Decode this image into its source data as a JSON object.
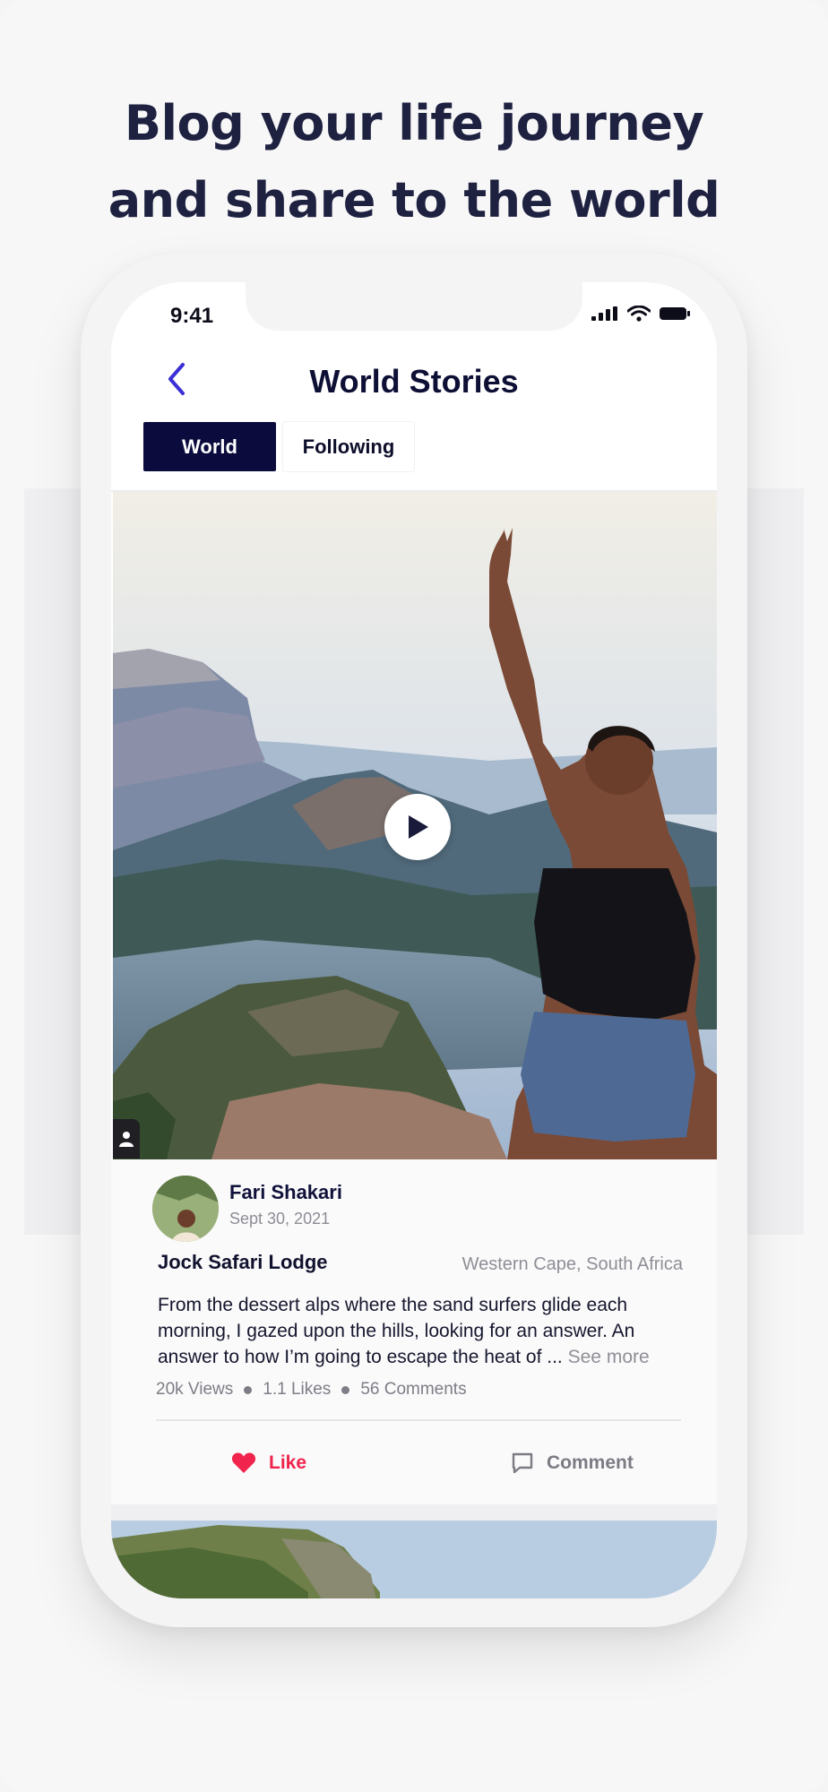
{
  "promo": {
    "headline_line1": "Blog your life journey",
    "headline_line2": "and share to the world"
  },
  "status_bar": {
    "time": "9:41",
    "icons": [
      "signal-icon",
      "wifi-icon",
      "battery-icon"
    ]
  },
  "header": {
    "title": "World Stories",
    "back_icon": "chevron-left-icon"
  },
  "tabs": [
    {
      "label": "World",
      "active": true
    },
    {
      "label": "Following",
      "active": false
    }
  ],
  "post": {
    "author": "Fari Shakari",
    "date": "Sept 30, 2021",
    "place": "Jock Safari Lodge",
    "location": "Western Cape, South Africa",
    "body": "From the dessert alps where the sand surfers glide each morning, I gazed upon the hills, looking for an answer. An answer to how I’m going to escape the heat of ...",
    "see_more": "See more",
    "views": "20k Views",
    "likes": "1.1 Likes",
    "comments": "56 Comments",
    "like_label": "Like",
    "comment_label": "Comment"
  },
  "colors": {
    "brand_dark": "#0b0c3d",
    "accent_back": "#3b2fd6",
    "like_red": "#f0244d",
    "muted": "#8e8e97"
  }
}
